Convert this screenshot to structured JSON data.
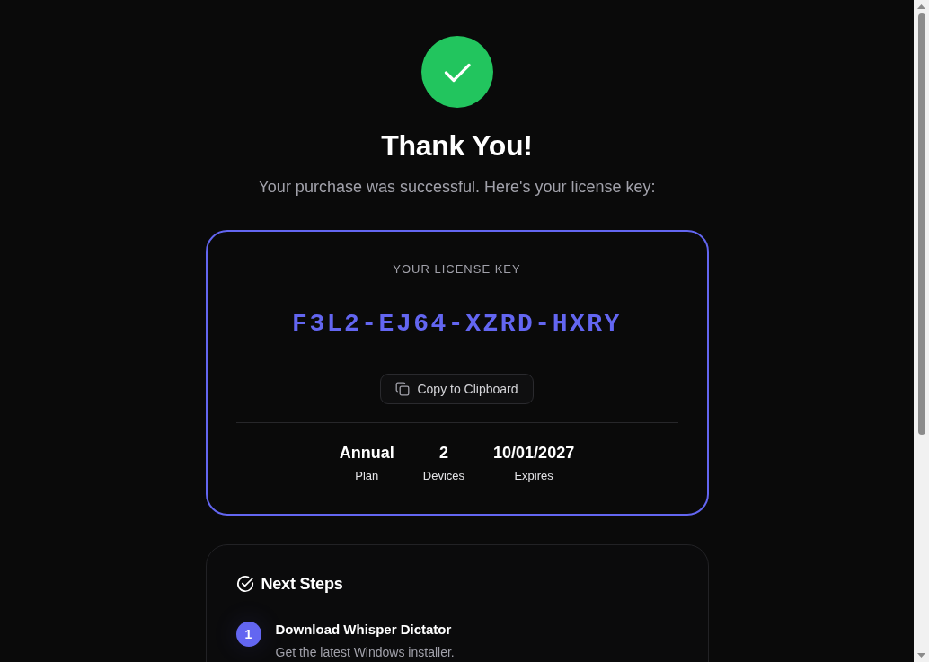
{
  "header": {
    "title": "Thank You!",
    "subtitle": "Your purchase was successful. Here's your license key:"
  },
  "license_card": {
    "label": "YOUR LICENSE KEY",
    "key": "F3L2-EJ64-XZRD-HXRY",
    "copy_button": "Copy to Clipboard",
    "stats": [
      {
        "value": "Annual",
        "label": "Plan"
      },
      {
        "value": "2",
        "label": "Devices"
      },
      {
        "value": "10/01/2027",
        "label": "Expires"
      }
    ]
  },
  "next_steps": {
    "title": "Next Steps",
    "steps": [
      {
        "number": "1",
        "title": "Download Whisper Dictator",
        "description": "Get the latest Windows installer."
      }
    ]
  }
}
